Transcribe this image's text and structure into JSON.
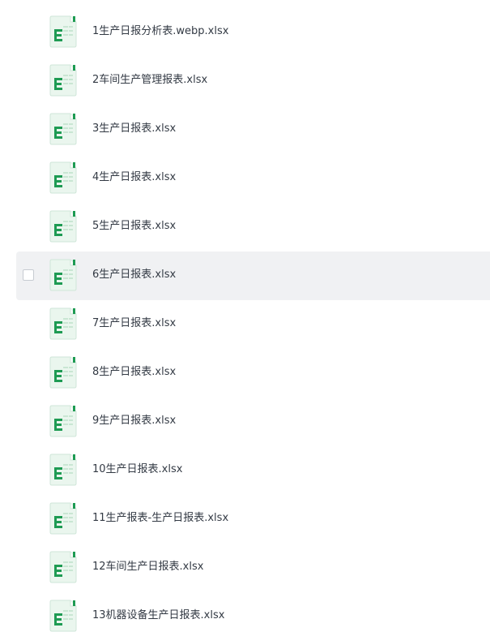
{
  "files": [
    {
      "name": "1生产日报分析表.webp.xlsx",
      "icon": "excel-file-icon",
      "hovered": false
    },
    {
      "name": "2车间生产管理报表.xlsx",
      "icon": "excel-file-icon",
      "hovered": false
    },
    {
      "name": "3生产日报表.xlsx",
      "icon": "excel-file-icon",
      "hovered": false
    },
    {
      "name": "4生产日报表.xlsx",
      "icon": "excel-file-icon",
      "hovered": false
    },
    {
      "name": "5生产日报表.xlsx",
      "icon": "excel-file-icon",
      "hovered": false
    },
    {
      "name": "6生产日报表.xlsx",
      "icon": "excel-file-icon",
      "hovered": true
    },
    {
      "name": "7生产日报表.xlsx",
      "icon": "excel-file-icon",
      "hovered": false
    },
    {
      "name": "8生产日报表.xlsx",
      "icon": "excel-file-icon",
      "hovered": false
    },
    {
      "name": "9生产日报表.xlsx",
      "icon": "excel-file-icon",
      "hovered": false
    },
    {
      "name": "10生产日报表.xlsx",
      "icon": "excel-file-icon",
      "hovered": false
    },
    {
      "name": "11生产报表-生产日报表.xlsx",
      "icon": "excel-file-icon",
      "hovered": false
    },
    {
      "name": "12车间生产日报表.xlsx",
      "icon": "excel-file-icon",
      "hovered": false
    },
    {
      "name": "13机器设备生产日报表.xlsx",
      "icon": "excel-file-icon",
      "hovered": false
    }
  ],
  "colors": {
    "icon_green": "#1e9b53",
    "icon_bg": "#eaf6ee",
    "icon_lines": "#c9e6d3",
    "hover_bg": "#f0f1f3",
    "text": "#333a44"
  }
}
